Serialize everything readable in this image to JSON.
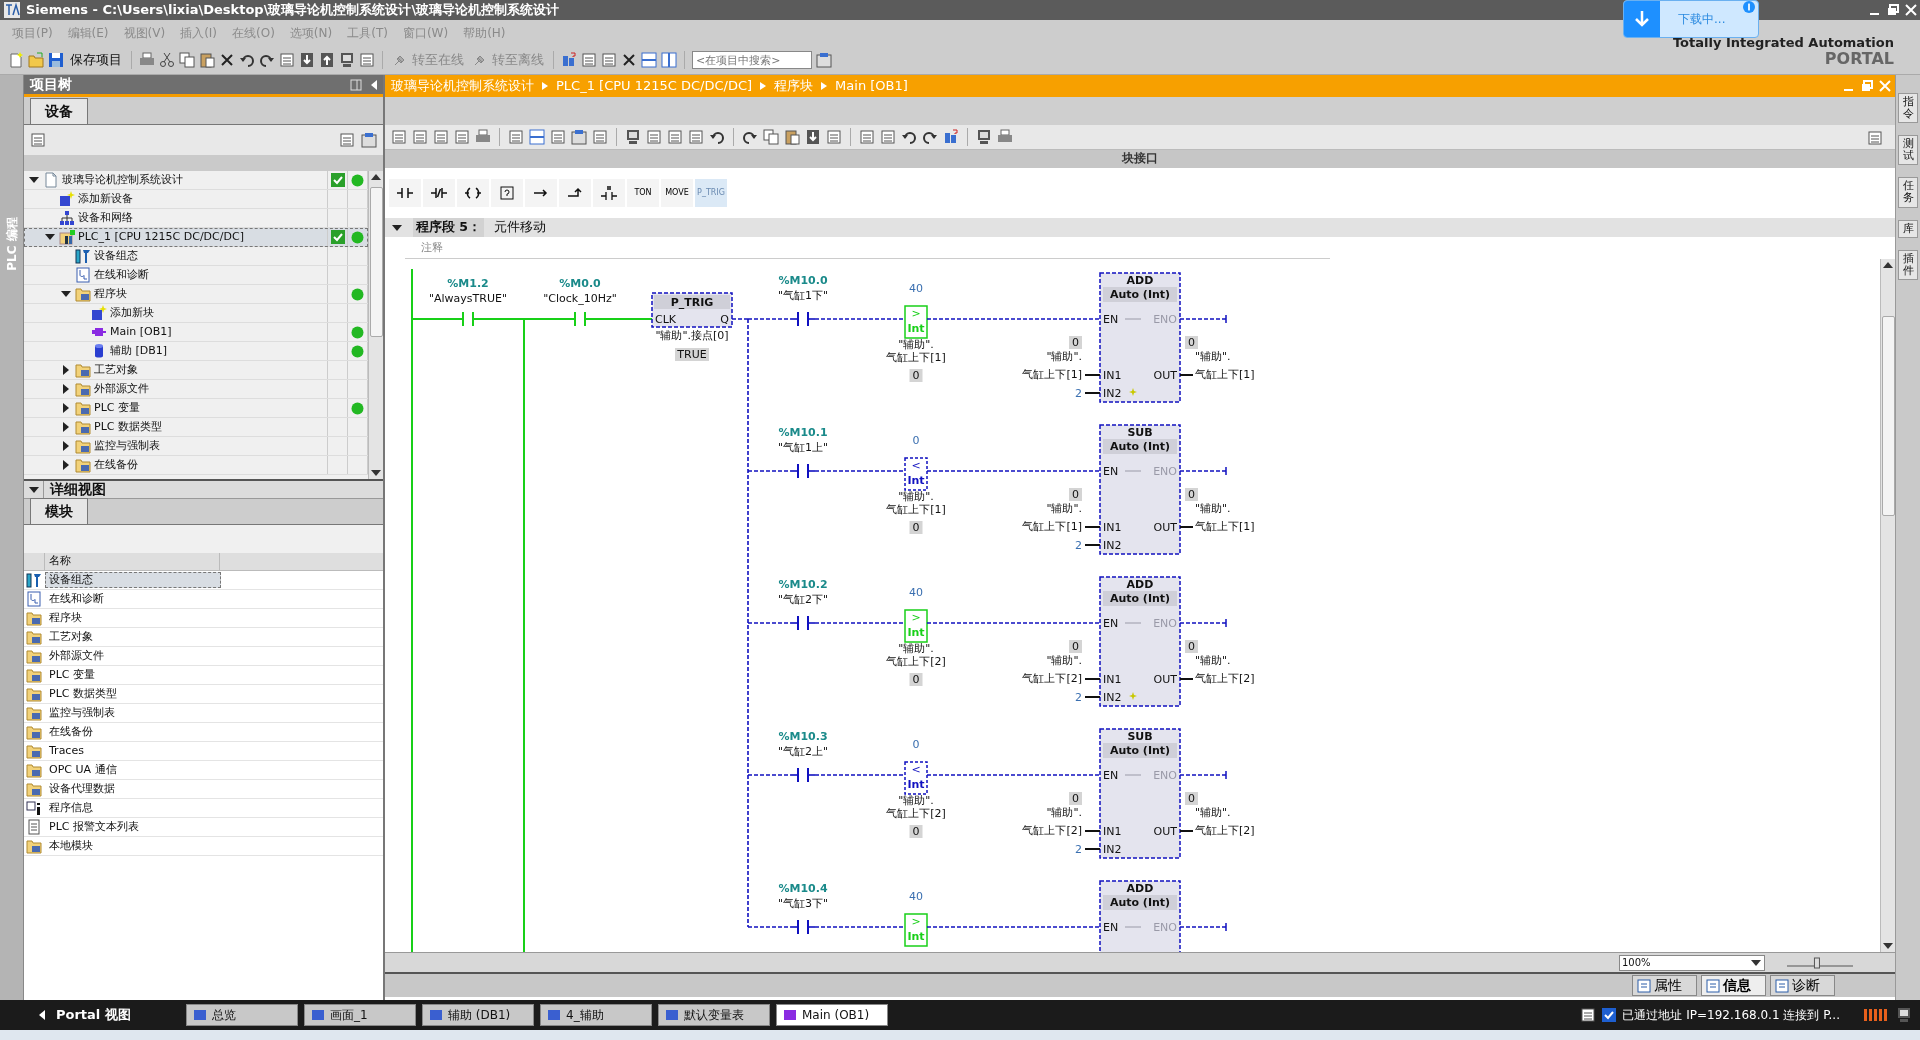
{
  "window": {
    "title": "Siemens  -  C:\\Users\\lixia\\Desktop\\玻璃导论机控制系统设计\\玻璃导论机控制系统设计"
  },
  "download_popup": {
    "text": "下载中..."
  },
  "menu": [
    "项目(P)",
    "编辑(E)",
    "视图(V)",
    "插入(I)",
    "在线(O)",
    "选项(N)",
    "工具(T)",
    "窗口(W)",
    "帮助(H)"
  ],
  "toolbar": [
    {
      "label": "保存项目",
      "disabled": false
    },
    {
      "label": "转至在线",
      "disabled": true
    },
    {
      "label": "转至离线",
      "disabled": true
    }
  ],
  "search": {
    "placeholder": "<在项目中搜索>"
  },
  "brand": {
    "line1": "Totally Integrated Automation",
    "line2": "PORTAL"
  },
  "side_strip": {
    "label": "PLC 编程"
  },
  "project_tree": {
    "title": "项目树",
    "tab": "设备",
    "items": [
      {
        "label": "玻璃导论机控制系统设计",
        "kind": "project",
        "expanded": true,
        "selected": false,
        "checked": true,
        "online_ok": true,
        "children": [
          {
            "label": "添加新设备",
            "kind": "add",
            "selected": false,
            "checked": false,
            "online_ok": false
          },
          {
            "label": "设备和网络",
            "kind": "network",
            "selected": false,
            "checked": false,
            "online_ok": false
          },
          {
            "label": "PLC_1 [CPU 1215C DC/DC/DC]",
            "kind": "plc",
            "expanded": true,
            "selected": true,
            "checked": true,
            "online_ok": true,
            "children": [
              {
                "label": "设备组态",
                "kind": "config",
                "selected": false,
                "checked": false,
                "online_ok": false
              },
              {
                "label": "在线和诊断",
                "kind": "diag",
                "selected": false,
                "checked": false,
                "online_ok": false
              },
              {
                "label": "程序块",
                "kind": "folder",
                "expanded": true,
                "selected": false,
                "checked": false,
                "online_ok": true,
                "children": [
                  {
                    "label": "添加新块",
                    "kind": "add",
                    "selected": false,
                    "checked": false,
                    "online_ok": false
                  },
                  {
                    "label": "Main [OB1]",
                    "kind": "ob",
                    "selected": false,
                    "checked": false,
                    "online_ok": true
                  },
                  {
                    "label": "辅助 [DB1]",
                    "kind": "db",
                    "selected": false,
                    "checked": false,
                    "online_ok": true
                  }
                ]
              },
              {
                "label": "工艺对象",
                "kind": "folder",
                "expanded": false,
                "selected": false,
                "checked": false,
                "online_ok": false
              },
              {
                "label": "外部源文件",
                "kind": "folder",
                "expanded": false,
                "selected": false,
                "checked": false,
                "online_ok": false
              },
              {
                "label": "PLC 变量",
                "kind": "folder",
                "expanded": false,
                "selected": false,
                "checked": false,
                "online_ok": true
              },
              {
                "label": "PLC 数据类型",
                "kind": "folder",
                "expanded": false,
                "selected": false,
                "checked": false,
                "online_ok": false
              },
              {
                "label": "监控与强制表",
                "kind": "folder",
                "expanded": false,
                "selected": false,
                "checked": false,
                "online_ok": false
              },
              {
                "label": "在线备份",
                "kind": "folder",
                "expanded": false,
                "selected": false,
                "checked": false,
                "online_ok": false
              }
            ]
          }
        ]
      }
    ]
  },
  "detail_view": {
    "title": "详细视图",
    "tab": "模块",
    "column": "名称",
    "items": [
      {
        "label": "设备组态",
        "kind": "config",
        "selected": true
      },
      {
        "label": "在线和诊断",
        "kind": "diag",
        "selected": false
      },
      {
        "label": "程序块",
        "kind": "folder",
        "selected": false
      },
      {
        "label": "工艺对象",
        "kind": "folder",
        "selected": false
      },
      {
        "label": "外部源文件",
        "kind": "folder",
        "selected": false
      },
      {
        "label": "PLC 变量",
        "kind": "folder",
        "selected": false
      },
      {
        "label": "PLC 数据类型",
        "kind": "folder",
        "selected": false
      },
      {
        "label": "监控与强制表",
        "kind": "folder",
        "selected": false
      },
      {
        "label": "在线备份",
        "kind": "folder",
        "selected": false
      },
      {
        "label": "Traces",
        "kind": "folder",
        "selected": false
      },
      {
        "label": "OPC UA 通信",
        "kind": "folder",
        "selected": false
      },
      {
        "label": "设备代理数据",
        "kind": "folder",
        "selected": false
      },
      {
        "label": "程序信息",
        "kind": "info",
        "selected": false
      },
      {
        "label": "PLC 报警文本列表",
        "kind": "list",
        "selected": false
      },
      {
        "label": "本地模块",
        "kind": "folder",
        "selected": false
      }
    ]
  },
  "editor": {
    "breadcrumb": [
      "玻璃导论机控制系统设计",
      "PLC_1 [CPU 1215C DC/DC/DC]",
      "程序块",
      "Main [OB1]"
    ],
    "interface_label": "块接口",
    "palette": [
      {
        "label": "TON",
        "selected": false
      },
      {
        "label": "MOVE",
        "selected": false
      },
      {
        "label": "P_TRIG",
        "selected": true
      }
    ],
    "network": {
      "label": "程序段 5：",
      "title": "元件移动",
      "comment_placeholder": "注释"
    },
    "ladder": {
      "contacts": [
        {
          "address": "%M1.2",
          "tag": "\"AlwaysTRUE\"",
          "powered": true
        },
        {
          "address": "%M0.0",
          "tag": "\"Clock_10Hz\"",
          "powered": true
        }
      ],
      "edge": {
        "name": "P_TRIG",
        "input": "CLK",
        "output": "Q",
        "operand": "\"辅助\".接点[0]",
        "value": "TRUE"
      },
      "branches": [
        {
          "address": "%M10.0",
          "tag": "\"气缸1下\"",
          "compare": {
            "op": ">",
            "type": "Int",
            "value": "40",
            "result": true,
            "operand_1": "\"辅助\".",
            "operand_2": "气缸上下[1]",
            "operand_value": "0"
          },
          "block": {
            "name": "ADD",
            "type": "Auto (Int)",
            "en": "EN",
            "eno": "ENO",
            "in1": "IN1",
            "in2": "IN2",
            "out": "OUT",
            "in1_value": "0",
            "in1_1": "\"辅助\".",
            "in1_2": "气缸上下[1]",
            "in2_value": "2",
            "out_value": "0",
            "out_1": "\"辅助\".",
            "out_2": "气缸上下[1]",
            "extendable": true
          }
        },
        {
          "address": "%M10.1",
          "tag": "\"气缸1上\"",
          "compare": {
            "op": "<",
            "type": "Int",
            "value": "0",
            "result": false,
            "operand_1": "\"辅助\".",
            "operand_2": "气缸上下[1]",
            "operand_value": "0"
          },
          "block": {
            "name": "SUB",
            "type": "Auto (Int)",
            "en": "EN",
            "eno": "ENO",
            "in1": "IN1",
            "in2": "IN2",
            "out": "OUT",
            "in1_value": "0",
            "in1_1": "\"辅助\".",
            "in1_2": "气缸上下[1]",
            "in2_value": "2",
            "out_value": "0",
            "out_1": "\"辅助\".",
            "out_2": "气缸上下[1]",
            "extendable": false
          }
        },
        {
          "address": "%M10.2",
          "tag": "\"气缸2下\"",
          "compare": {
            "op": ">",
            "type": "Int",
            "value": "40",
            "result": true,
            "operand_1": "\"辅助\".",
            "operand_2": "气缸上下[2]",
            "operand_value": "0"
          },
          "block": {
            "name": "ADD",
            "type": "Auto (Int)",
            "en": "EN",
            "eno": "ENO",
            "in1": "IN1",
            "in2": "IN2",
            "out": "OUT",
            "in1_value": "0",
            "in1_1": "\"辅助\".",
            "in1_2": "气缸上下[2]",
            "in2_value": "2",
            "out_value": "0",
            "out_1": "\"辅助\".",
            "out_2": "气缸上下[2]",
            "extendable": true
          }
        },
        {
          "address": "%M10.3",
          "tag": "\"气缸2上\"",
          "compare": {
            "op": "<",
            "type": "Int",
            "value": "0",
            "result": false,
            "operand_1": "\"辅助\".",
            "operand_2": "气缸上下[2]",
            "operand_value": "0"
          },
          "block": {
            "name": "SUB",
            "type": "Auto (Int)",
            "en": "EN",
            "eno": "ENO",
            "in1": "IN1",
            "in2": "IN2",
            "out": "OUT",
            "in1_value": "0",
            "in1_1": "\"辅助\".",
            "in1_2": "气缸上下[2]",
            "in2_value": "2",
            "out_value": "0",
            "out_1": "\"辅助\".",
            "out_2": "气缸上下[2]",
            "extendable": false
          }
        },
        {
          "address": "%M10.4",
          "tag": "\"气缸3下\"",
          "compare": {
            "op": ">",
            "type": "Int",
            "value": "40",
            "result": true
          },
          "block": {
            "name": "ADD",
            "type": "Auto (Int)",
            "en": "EN",
            "eno": "ENO",
            "extendable": false
          }
        }
      ]
    },
    "zoom": "100%",
    "zoom_slider": {
      "level": 0.45
    }
  },
  "right_tabs": [
    "指令",
    "测试",
    "任务",
    "库",
    "插件"
  ],
  "inspector_tabs": [
    {
      "label": "属性",
      "selected": false
    },
    {
      "label": "信息",
      "selected": true
    },
    {
      "label": "诊断",
      "selected": false
    }
  ],
  "taskbar": {
    "portal": "Portal 视图",
    "tabs": [
      {
        "label": "总览",
        "selected": false
      },
      {
        "label": "画面_1",
        "selected": false
      },
      {
        "label": "辅助 (DB1)",
        "selected": false
      },
      {
        "label": "4_辅助",
        "selected": false
      },
      {
        "label": "默认变量表",
        "selected": false
      },
      {
        "label": "Main (OB1)",
        "selected": true
      }
    ],
    "status": "已通过地址 IP=192.168.0.1 连接到 P..."
  }
}
